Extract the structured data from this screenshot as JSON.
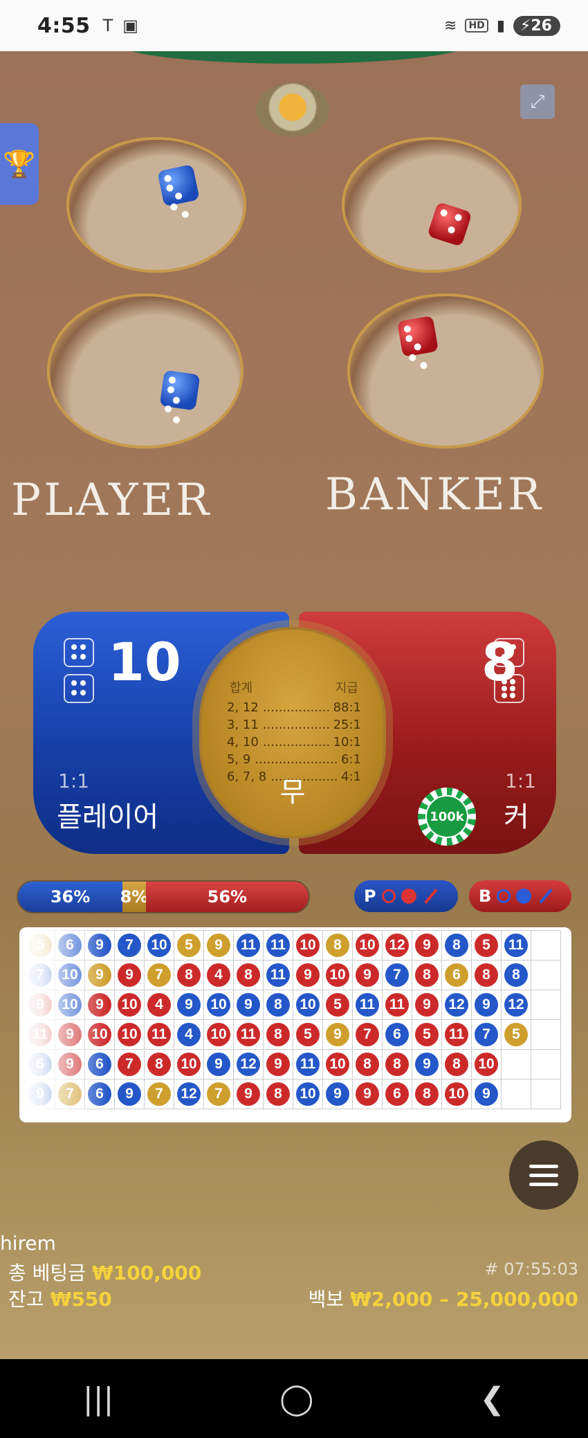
{
  "status_bar": {
    "time": "4:55",
    "left_icons": [
      "T-icon",
      "screen-capture-icon"
    ],
    "network_badge": "HD",
    "battery": "26"
  },
  "table": {
    "player_label": "PLAYER",
    "banker_label": "BANKER",
    "dice": {
      "player": [
        5,
        5
      ],
      "banker": [
        3,
        5
      ]
    }
  },
  "score_panel": {
    "player": {
      "score": "10",
      "odds": "1:1",
      "name": "플레이어",
      "dice": [
        4,
        4
      ]
    },
    "banker": {
      "score": "8",
      "odds": "1:1",
      "name": "커",
      "dice": [
        2,
        6
      ]
    },
    "tie": {
      "header_left": "합계",
      "header_right": "지급",
      "rows": [
        {
          "sum": "2, 12",
          "pay": "88:1"
        },
        {
          "sum": "3, 11",
          "pay": "25:1"
        },
        {
          "sum": "4, 10",
          "pay": "10:1"
        },
        {
          "sum": "5, 9",
          "pay": "6:1"
        },
        {
          "sum": "6, 7, 8",
          "pay": "4:1"
        }
      ],
      "label": "무"
    },
    "chip_label": "100k"
  },
  "stats": {
    "player_pct": "36%",
    "tie_pct": "8%",
    "banker_pct": "56%",
    "player_pct_value": 36,
    "tie_pct_value": 8,
    "banker_pct_value": 56,
    "predict_player_label": "P",
    "predict_banker_label": "B"
  },
  "roadmap": {
    "rows": [
      [
        [
          "T",
          "5"
        ],
        [
          "P",
          "6"
        ],
        [
          "P",
          "9"
        ],
        [
          "P",
          "7"
        ],
        [
          "P",
          "10"
        ],
        [
          "T",
          "5"
        ],
        [
          "T",
          "9"
        ],
        [
          "P",
          "11"
        ],
        [
          "P",
          "11"
        ],
        [
          "B",
          "10"
        ],
        [
          "T",
          "8"
        ],
        [
          "B",
          "10"
        ],
        [
          "B",
          "12"
        ],
        [
          "B",
          "9"
        ],
        [
          "P",
          "8"
        ],
        [
          "B",
          "5"
        ],
        [
          "P",
          "11"
        ],
        [
          "",
          ""
        ]
      ],
      [
        [
          "P",
          "7"
        ],
        [
          "P",
          "10"
        ],
        [
          "T",
          "9"
        ],
        [
          "B",
          "9"
        ],
        [
          "T",
          "7"
        ],
        [
          "B",
          "8"
        ],
        [
          "B",
          "4"
        ],
        [
          "B",
          "8"
        ],
        [
          "P",
          "11"
        ],
        [
          "B",
          "9"
        ],
        [
          "B",
          "10"
        ],
        [
          "B",
          "9"
        ],
        [
          "P",
          "7"
        ],
        [
          "B",
          "8"
        ],
        [
          "T",
          "6"
        ],
        [
          "B",
          "8"
        ],
        [
          "P",
          "8"
        ],
        [
          "",
          ""
        ]
      ],
      [
        [
          "B",
          "9"
        ],
        [
          "P",
          "10"
        ],
        [
          "B",
          "9"
        ],
        [
          "B",
          "10"
        ],
        [
          "B",
          "4"
        ],
        [
          "P",
          "9"
        ],
        [
          "P",
          "10"
        ],
        [
          "P",
          "9"
        ],
        [
          "P",
          "8"
        ],
        [
          "P",
          "10"
        ],
        [
          "B",
          "5"
        ],
        [
          "P",
          "11"
        ],
        [
          "B",
          "11"
        ],
        [
          "B",
          "9"
        ],
        [
          "P",
          "12"
        ],
        [
          "P",
          "9"
        ],
        [
          "P",
          "12"
        ],
        [
          "",
          ""
        ]
      ],
      [
        [
          "B",
          "11"
        ],
        [
          "B",
          "9"
        ],
        [
          "B",
          "10"
        ],
        [
          "B",
          "10"
        ],
        [
          "B",
          "11"
        ],
        [
          "P",
          "4"
        ],
        [
          "B",
          "10"
        ],
        [
          "B",
          "11"
        ],
        [
          "B",
          "8"
        ],
        [
          "B",
          "5"
        ],
        [
          "T",
          "9"
        ],
        [
          "B",
          "7"
        ],
        [
          "P",
          "6"
        ],
        [
          "B",
          "5"
        ],
        [
          "B",
          "11"
        ],
        [
          "P",
          "7"
        ],
        [
          "T",
          "5"
        ],
        [
          "",
          ""
        ]
      ],
      [
        [
          "P",
          "6"
        ],
        [
          "B",
          "9"
        ],
        [
          "P",
          "6"
        ],
        [
          "B",
          "7"
        ],
        [
          "B",
          "8"
        ],
        [
          "B",
          "10"
        ],
        [
          "P",
          "9"
        ],
        [
          "P",
          "12"
        ],
        [
          "B",
          "9"
        ],
        [
          "P",
          "11"
        ],
        [
          "B",
          "10"
        ],
        [
          "B",
          "8"
        ],
        [
          "B",
          "8"
        ],
        [
          "P",
          "9"
        ],
        [
          "B",
          "8"
        ],
        [
          "B",
          "10"
        ],
        [
          "",
          ""
        ],
        [
          "",
          ""
        ]
      ],
      [
        [
          "P",
          "9"
        ],
        [
          "T",
          "7"
        ],
        [
          "P",
          "6"
        ],
        [
          "P",
          "9"
        ],
        [
          "T",
          "7"
        ],
        [
          "P",
          "12"
        ],
        [
          "T",
          "7"
        ],
        [
          "B",
          "9"
        ],
        [
          "B",
          "8"
        ],
        [
          "P",
          "10"
        ],
        [
          "P",
          "9"
        ],
        [
          "B",
          "9"
        ],
        [
          "B",
          "6"
        ],
        [
          "B",
          "8"
        ],
        [
          "B",
          "10"
        ],
        [
          "P",
          "9"
        ],
        [
          "",
          ""
        ],
        [
          "",
          ""
        ]
      ]
    ]
  },
  "footer": {
    "username": "hirem",
    "total_bet_label": "총 베팅금",
    "total_bet_value": "₩100,000",
    "balance_label": "잔고",
    "balance_value": "₩550",
    "round_id": "# 07:55:03",
    "limit_label": "백보",
    "limit_value": "₩2,000 – 25,000,000"
  },
  "colors": {
    "player": "#2457c8",
    "banker": "#cc2a2a",
    "tie": "#cf9f2e",
    "highlight": "#f4d33c"
  }
}
